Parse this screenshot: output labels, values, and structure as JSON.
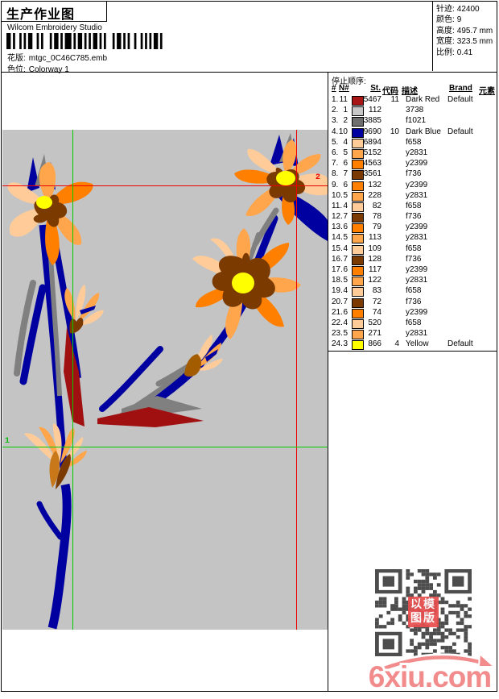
{
  "header": {
    "title": "生产作业图",
    "subtitle": "Wilcom Embroidery Studio",
    "pattern_label": "花版:",
    "pattern_value": "mtgc_0C46C785.emb",
    "colorway_label": "色位:",
    "colorway_value": "Colorway 1",
    "stats": [
      {
        "label": "针迹:",
        "value": "42400"
      },
      {
        "label": "颜色:",
        "value": "9"
      },
      {
        "label": "高度:",
        "value": "495.7 mm"
      },
      {
        "label": "宽度:",
        "value": "323.5 mm"
      },
      {
        "label": "比例:",
        "value": "0.41"
      }
    ]
  },
  "stop_sequence": {
    "title": "停止顺序:",
    "columns": [
      "#",
      "N#",
      "St.",
      "代码",
      "描述",
      "Brand",
      "元素"
    ],
    "rows": [
      {
        "idx": "1.",
        "n": "11",
        "color": "#a81616",
        "st": "5467",
        "code": "11",
        "desc": "Dark Red",
        "brand": "Default",
        "elem": ""
      },
      {
        "idx": "2.",
        "n": "1",
        "color": "#c8c8c8",
        "st": "112",
        "code": "",
        "desc": "3738",
        "brand": "",
        "elem": ""
      },
      {
        "idx": "3.",
        "n": "2",
        "color": "#6e6e6e",
        "st": "3885",
        "code": "",
        "desc": "f1021",
        "brand": "",
        "elem": ""
      },
      {
        "idx": "4.",
        "n": "10",
        "color": "#0000a0",
        "st": "9690",
        "code": "10",
        "desc": "Dark Blue",
        "brand": "Default",
        "elem": ""
      },
      {
        "idx": "5.",
        "n": "4",
        "color": "#ffcc99",
        "st": "6894",
        "code": "",
        "desc": "f658",
        "brand": "",
        "elem": ""
      },
      {
        "idx": "6.",
        "n": "5",
        "color": "#ffa64d",
        "st": "5152",
        "code": "",
        "desc": "y2831",
        "brand": "",
        "elem": ""
      },
      {
        "idx": "7.",
        "n": "6",
        "color": "#ff8000",
        "st": "4563",
        "code": "",
        "desc": "y2399",
        "brand": "",
        "elem": ""
      },
      {
        "idx": "8.",
        "n": "7",
        "color": "#7b3a00",
        "st": "3561",
        "code": "",
        "desc": "f736",
        "brand": "",
        "elem": ""
      },
      {
        "idx": "9.",
        "n": "6",
        "color": "#ff8000",
        "st": "132",
        "code": "",
        "desc": "y2399",
        "brand": "",
        "elem": ""
      },
      {
        "idx": "10.",
        "n": "5",
        "color": "#ffa64d",
        "st": "228",
        "code": "",
        "desc": "y2831",
        "brand": "",
        "elem": ""
      },
      {
        "idx": "11.",
        "n": "4",
        "color": "#ffcc99",
        "st": "82",
        "code": "",
        "desc": "f658",
        "brand": "",
        "elem": ""
      },
      {
        "idx": "12.",
        "n": "7",
        "color": "#7b3a00",
        "st": "78",
        "code": "",
        "desc": "f736",
        "brand": "",
        "elem": ""
      },
      {
        "idx": "13.",
        "n": "6",
        "color": "#ff8000",
        "st": "79",
        "code": "",
        "desc": "y2399",
        "brand": "",
        "elem": ""
      },
      {
        "idx": "14.",
        "n": "5",
        "color": "#ffa64d",
        "st": "113",
        "code": "",
        "desc": "y2831",
        "brand": "",
        "elem": ""
      },
      {
        "idx": "15.",
        "n": "4",
        "color": "#ffcc99",
        "st": "109",
        "code": "",
        "desc": "f658",
        "brand": "",
        "elem": ""
      },
      {
        "idx": "16.",
        "n": "7",
        "color": "#7b3a00",
        "st": "128",
        "code": "",
        "desc": "f736",
        "brand": "",
        "elem": ""
      },
      {
        "idx": "17.",
        "n": "6",
        "color": "#ff8000",
        "st": "117",
        "code": "",
        "desc": "y2399",
        "brand": "",
        "elem": ""
      },
      {
        "idx": "18.",
        "n": "5",
        "color": "#ffa64d",
        "st": "122",
        "code": "",
        "desc": "y2831",
        "brand": "",
        "elem": ""
      },
      {
        "idx": "19.",
        "n": "4",
        "color": "#ffcc99",
        "st": "83",
        "code": "",
        "desc": "f658",
        "brand": "",
        "elem": ""
      },
      {
        "idx": "20.",
        "n": "7",
        "color": "#7b3a00",
        "st": "72",
        "code": "",
        "desc": "f736",
        "brand": "",
        "elem": ""
      },
      {
        "idx": "21.",
        "n": "6",
        "color": "#ff8000",
        "st": "74",
        "code": "",
        "desc": "y2399",
        "brand": "",
        "elem": ""
      },
      {
        "idx": "22.",
        "n": "4",
        "color": "#ffcc99",
        "st": "520",
        "code": "",
        "desc": "f658",
        "brand": "",
        "elem": ""
      },
      {
        "idx": "23.",
        "n": "5",
        "color": "#ffa64d",
        "st": "271",
        "code": "",
        "desc": "y2831",
        "brand": "",
        "elem": ""
      },
      {
        "idx": "24.",
        "n": "3",
        "color": "#ffff00",
        "st": "866",
        "code": "4",
        "desc": "Yellow",
        "brand": "Default",
        "elem": ""
      }
    ]
  },
  "canvas": {
    "background": "#c4c4c4",
    "markers": {
      "green_label": "1",
      "red_label": "2"
    },
    "guide_colors": {
      "green": "#00cc00",
      "red": "#ee0000"
    },
    "palette": {
      "dark_red": "#a01010",
      "gray": "#808080",
      "dark_blue": "#0000a0",
      "peach": "#ffcc99",
      "light_orange": "#ffa64d",
      "orange": "#ff8000",
      "dark_brown": "#7b3a00",
      "yellow": "#ffff00"
    }
  },
  "watermark": {
    "stamp_line1": "以模",
    "stamp_line2": "图版",
    "logo": "6xiu.com",
    "logo_color": "#f28b8b"
  }
}
